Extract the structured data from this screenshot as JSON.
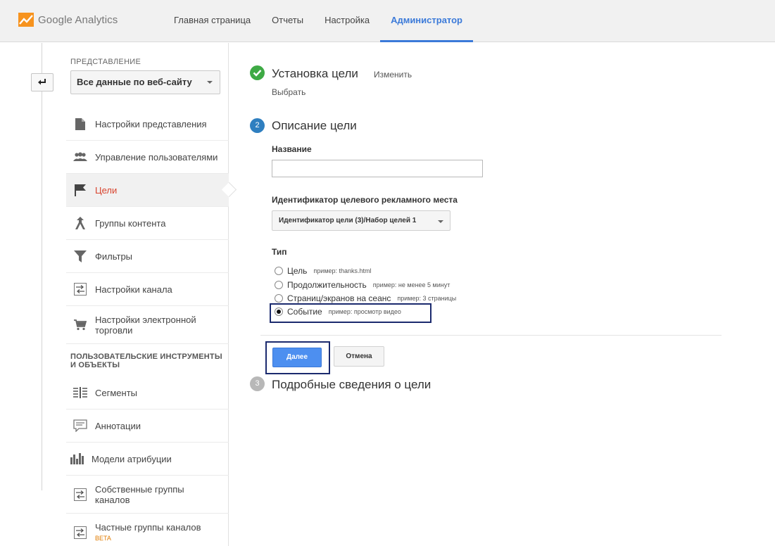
{
  "header": {
    "logo_text": "Google Analytics",
    "nav": [
      {
        "label": "Главная страница"
      },
      {
        "label": "Отчеты"
      },
      {
        "label": "Настройка"
      },
      {
        "label": "Администратор"
      }
    ],
    "active_nav": "Администратор",
    "accent_color": "#3b7ad9"
  },
  "sidebar": {
    "back_icon": "back-arrow-icon",
    "view_label": "ПРЕДСТАВЛЕНИЕ",
    "view_selected": "Все данные по веб-сайту",
    "items": [
      {
        "label": "Настройки представления",
        "icon": "document-icon"
      },
      {
        "label": "Управление пользователями",
        "icon": "users-icon"
      },
      {
        "label": "Цели",
        "icon": "flag-icon",
        "active": true
      },
      {
        "label": "Группы контента",
        "icon": "merge-icon"
      },
      {
        "label": "Фильтры",
        "icon": "filter-icon"
      },
      {
        "label": "Настройки канала",
        "icon": "channel-icon"
      },
      {
        "label": "Настройки электронной торговли",
        "icon": "cart-icon"
      }
    ],
    "section_title": "ПОЛЬЗОВАТЕЛЬСКИЕ ИНСТРУМЕНТЫ И ОБЪЕКТЫ",
    "tools": [
      {
        "label": "Сегменты",
        "icon": "segments-icon"
      },
      {
        "label": "Аннотации",
        "icon": "annotation-icon"
      },
      {
        "label": "Модели атрибуции",
        "icon": "bar-chart-icon"
      },
      {
        "label": "Собственные группы каналов",
        "icon": "channel-icon"
      },
      {
        "label": "Частные группы каналов",
        "badge": "BETA",
        "icon": "channel-icon"
      }
    ],
    "active_color": "#d8432d"
  },
  "goal": {
    "step1": {
      "title": "Установка цели",
      "change": "Изменить",
      "value": "Выбрать"
    },
    "step2": {
      "number": "2",
      "title": "Описание цели"
    },
    "name_label": "Название",
    "name_value": "",
    "slot_label": "Идентификатор целевого рекламного места",
    "slot_value": "Идентификатор цели (3)/Набор целей 1",
    "type_label": "Тип",
    "types": [
      {
        "label": "Цель",
        "example": "пример: thanks.html",
        "checked": false
      },
      {
        "label": "Продолжительность",
        "example": "пример: не менее 5 минут",
        "checked": false
      },
      {
        "label": "Страниц/экранов на сеанс",
        "example": "пример: 3 страницы",
        "checked": false
      },
      {
        "label": "Событие",
        "example": "пример: просмотр видео",
        "checked": true
      }
    ],
    "next_button": "Далее",
    "cancel_button": "Отмена",
    "step3": {
      "number": "3",
      "title": "Подробные сведения о цели"
    },
    "done_color": "#3eaa45",
    "step_color": "#2f7fc0"
  }
}
